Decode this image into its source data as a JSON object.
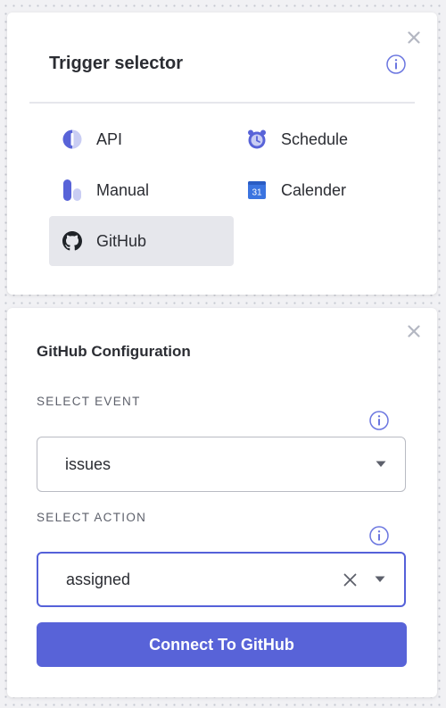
{
  "trigger_selector": {
    "title": "Trigger selector",
    "options": [
      {
        "label": "API",
        "icon": "api-icon"
      },
      {
        "label": "Schedule",
        "icon": "schedule-icon"
      },
      {
        "label": "Manual",
        "icon": "manual-icon"
      },
      {
        "label": "Calender",
        "icon": "calendar-icon",
        "icon_text": "31"
      },
      {
        "label": "GitHub",
        "icon": "github-icon",
        "selected": true
      }
    ]
  },
  "github_config": {
    "title": "GitHub Configuration",
    "event": {
      "label": "SELECT EVENT",
      "value": "issues"
    },
    "action": {
      "label": "SELECT ACTION",
      "value": "assigned"
    },
    "connect_button": "Connect To GitHub"
  },
  "colors": {
    "accent": "#5863d8",
    "icon_blue": "#6b76e0",
    "selected_bg": "#e6e7ec"
  }
}
